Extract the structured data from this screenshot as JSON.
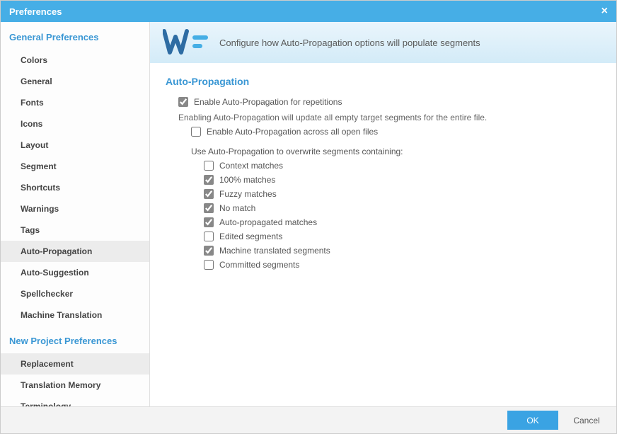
{
  "window": {
    "title": "Preferences"
  },
  "sidebar": {
    "groups": [
      {
        "header": "General Preferences",
        "items": [
          {
            "label": "Colors",
            "active": false
          },
          {
            "label": "General",
            "active": false
          },
          {
            "label": "Fonts",
            "active": false
          },
          {
            "label": "Icons",
            "active": false
          },
          {
            "label": "Layout",
            "active": false
          },
          {
            "label": "Segment",
            "active": false
          },
          {
            "label": "Shortcuts",
            "active": false
          },
          {
            "label": "Warnings",
            "active": false
          },
          {
            "label": "Tags",
            "active": false
          },
          {
            "label": "Auto-Propagation",
            "active": true
          },
          {
            "label": "Auto-Suggestion",
            "active": false
          },
          {
            "label": "Spellchecker",
            "active": false
          },
          {
            "label": "Machine Translation",
            "active": false
          }
        ]
      },
      {
        "header": "New Project Preferences",
        "items": [
          {
            "label": "Replacement",
            "active": true
          },
          {
            "label": "Translation Memory",
            "active": false
          },
          {
            "label": "Terminology",
            "active": false
          }
        ]
      }
    ]
  },
  "banner": {
    "description": "Configure how Auto-Propagation options will populate segments"
  },
  "section": {
    "title": "Auto-Propagation",
    "enable_label": "Enable Auto-Propagation for repetitions",
    "enable_checked": true,
    "helper": "Enabling Auto-Propagation will update all empty target segments for the entire file.",
    "across_label": "Enable Auto-Propagation across all open files",
    "across_checked": false,
    "overwrite_heading": "Use Auto-Propagation to overwrite segments containing:",
    "options": [
      {
        "label": "Context matches",
        "checked": false
      },
      {
        "label": "100% matches",
        "checked": true
      },
      {
        "label": "Fuzzy matches",
        "checked": true
      },
      {
        "label": "No match",
        "checked": true
      },
      {
        "label": "Auto-propagated matches",
        "checked": true
      },
      {
        "label": "Edited segments",
        "checked": false
      },
      {
        "label": "Machine translated segments",
        "checked": true
      },
      {
        "label": "Committed segments",
        "checked": false
      }
    ]
  },
  "footer": {
    "ok": "OK",
    "cancel": "Cancel"
  },
  "colors": {
    "accent": "#46aee6",
    "link": "#3a97d4"
  }
}
